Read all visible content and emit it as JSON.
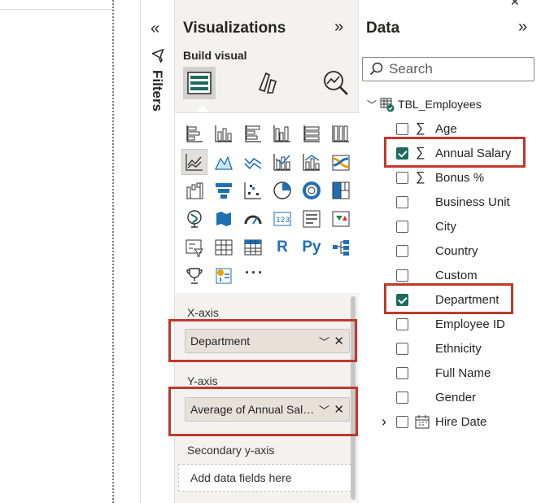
{
  "filters": {
    "label": "Filters"
  },
  "visualizations": {
    "title": "Visualizations",
    "build_label": "Build visual",
    "x_axis": {
      "label": "X-axis",
      "field": "Department"
    },
    "y_axis": {
      "label": "Y-axis",
      "field": "Average of Annual Salary"
    },
    "secondary_y_axis": {
      "label": "Secondary y-axis",
      "placeholder": "Add data fields here"
    },
    "gallery_more": "···",
    "r_label": "R",
    "py_label": "Py"
  },
  "data_pane": {
    "title": "Data",
    "search_placeholder": "Search",
    "table_name": "TBL_Employees",
    "fields": [
      {
        "name": "Age",
        "sigma": true,
        "checked": false
      },
      {
        "name": "Annual Salary",
        "sigma": true,
        "checked": true
      },
      {
        "name": "Bonus %",
        "sigma": true,
        "checked": false
      },
      {
        "name": "Business Unit",
        "sigma": false,
        "checked": false
      },
      {
        "name": "City",
        "sigma": false,
        "checked": false
      },
      {
        "name": "Country",
        "sigma": false,
        "checked": false
      },
      {
        "name": "Custom",
        "sigma": false,
        "checked": false
      },
      {
        "name": "Department",
        "sigma": false,
        "checked": true
      },
      {
        "name": "Employee ID",
        "sigma": false,
        "checked": false
      },
      {
        "name": "Ethnicity",
        "sigma": false,
        "checked": false
      },
      {
        "name": "Full Name",
        "sigma": false,
        "checked": false
      },
      {
        "name": "Gender",
        "sigma": false,
        "checked": false
      },
      {
        "name": "Hire Date",
        "sigma": false,
        "checked": false,
        "calendar": true,
        "expandable": true
      }
    ]
  },
  "colors": {
    "accent": "#1b6b5e",
    "highlight_box": "#c0392b",
    "pane_bg": "#f3f2f1"
  }
}
